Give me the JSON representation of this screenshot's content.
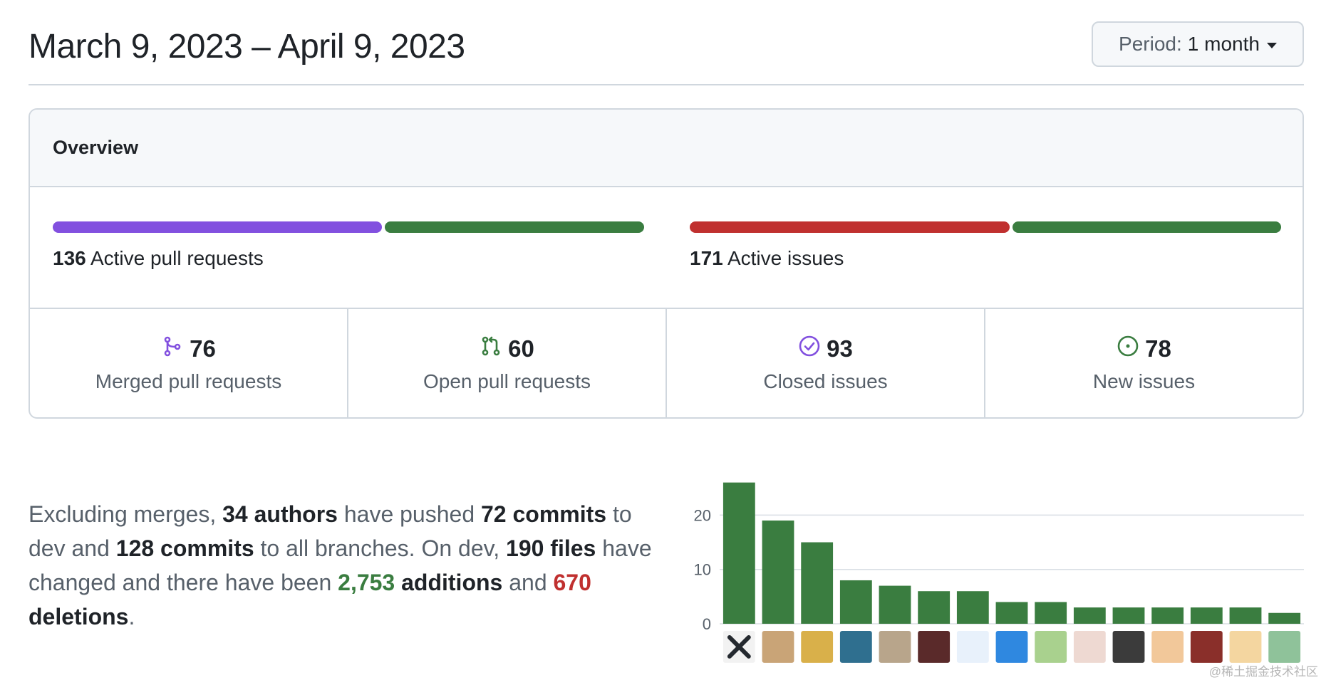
{
  "header": {
    "date_range": "March 9, 2023 – April 9, 2023",
    "period_label": "Period:",
    "period_value": "1 month"
  },
  "overview": {
    "title": "Overview",
    "pull_requests": {
      "count": "136",
      "label": "Active pull requests",
      "merged_fraction": 76,
      "open_fraction": 60,
      "colors": {
        "merged": "#8250df",
        "open": "#3a7d40"
      }
    },
    "issues": {
      "count": "171",
      "label": "Active issues",
      "closed_fraction": 93,
      "new_fraction": 78,
      "colors": {
        "closed": "#c0302f",
        "new": "#3a7d40"
      }
    },
    "stats": [
      {
        "icon": "merge-icon",
        "value": "76",
        "label": "Merged pull requests",
        "color": "#8250df"
      },
      {
        "icon": "pull-request-icon",
        "value": "60",
        "label": "Open pull requests",
        "color": "#3a7d40"
      },
      {
        "icon": "issue-closed-icon",
        "value": "93",
        "label": "Closed issues",
        "color": "#8250df"
      },
      {
        "icon": "issue-opened-icon",
        "value": "78",
        "label": "New issues",
        "color": "#3a7d40"
      }
    ]
  },
  "summary": {
    "t1": "Excluding merges, ",
    "authors": "34 authors",
    "t2": " have pushed ",
    "commits_dev": "72 commits",
    "t3": " to dev and ",
    "commits_all": "128 commits",
    "t4": " to all branches. On dev, ",
    "files": "190 files",
    "t5": " have changed and there have been ",
    "additions_num": "2,753",
    "additions_word": " additions",
    "t6": " and ",
    "deletions_num": "670",
    "deletions_word": " deletions",
    "t7": "."
  },
  "chart_data": {
    "type": "bar",
    "values": [
      26,
      19,
      15,
      8,
      7,
      6,
      6,
      4,
      4,
      3,
      3,
      3,
      3,
      3,
      2
    ],
    "ylim": [
      0,
      27
    ],
    "yticks": [
      "0",
      "10",
      "20"
    ],
    "bar_color": "#3a7d40",
    "avatar_colors": [
      "#f2f2f2",
      "#c9a477",
      "#d9b04a",
      "#2f6f8f",
      "#b8a58b",
      "#5a2a2a",
      "#e8f1fb",
      "#2f88e0",
      "#a9d18e",
      "#eed9d2",
      "#3b3b3b",
      "#f2c89a",
      "#8a2f2a",
      "#f4d6a0",
      "#8fc29a"
    ],
    "grid": true
  },
  "watermark": "@稀土掘金技术社区"
}
